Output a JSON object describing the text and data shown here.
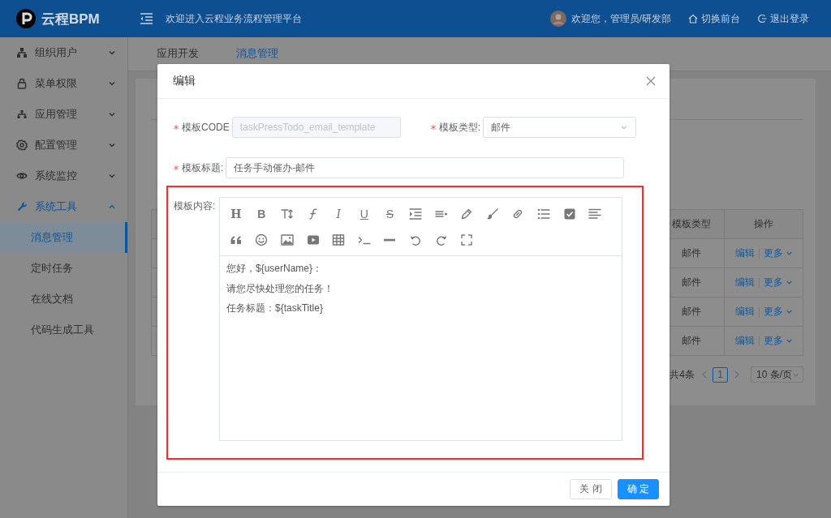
{
  "header": {
    "brand": "云程BPM",
    "welcome": "欢迎进入云程业务流程管理平台",
    "user": "欢迎您，管理员/研发部",
    "actions": [
      {
        "kind": "home",
        "label": "切换前台"
      },
      {
        "kind": "logout",
        "label": "退出登录"
      }
    ]
  },
  "sidebar": {
    "items": [
      {
        "kind": "org",
        "label": "组织用户",
        "expanded": false
      },
      {
        "kind": "lock",
        "label": "菜单权限",
        "expanded": false
      },
      {
        "kind": "apps",
        "label": "应用管理",
        "expanded": false
      },
      {
        "kind": "gear",
        "label": "配置管理",
        "expanded": false
      },
      {
        "kind": "eye",
        "label": "系统监控",
        "expanded": false
      },
      {
        "kind": "wrench",
        "label": "系统工具",
        "expanded": true,
        "children": [
          {
            "label": "消息管理",
            "selected": true
          },
          {
            "label": "定时任务",
            "selected": false
          },
          {
            "label": "在线文档",
            "selected": false
          },
          {
            "label": "代码生成工具",
            "selected": false
          }
        ]
      }
    ]
  },
  "tabs": [
    {
      "label": "应用开发",
      "selected": false
    },
    {
      "label": "消息管理",
      "selected": true
    }
  ],
  "table": {
    "columns": [
      "模板类型",
      "操作"
    ],
    "rows": [
      {
        "type": "邮件",
        "actions": [
          "编辑",
          "更多"
        ]
      },
      {
        "type": "邮件",
        "actions": [
          "编辑",
          "更多"
        ]
      },
      {
        "type": "邮件",
        "actions": [
          "编辑",
          "更多"
        ]
      },
      {
        "type": "邮件",
        "actions": [
          "编辑",
          "更多"
        ]
      }
    ]
  },
  "pagination": {
    "total": "共4条",
    "pages": [
      {
        "label": "1",
        "selected": true
      }
    ],
    "page_size": "10 条/页"
  },
  "dialog": {
    "title": "编辑",
    "form_rows": [
      [
        {
          "label": "模板CODE",
          "required": true,
          "kind": "input",
          "value": "taskPressTodo_email_template",
          "disabled": true
        },
        {
          "label": "模板类型:",
          "required": true,
          "kind": "select",
          "value": "邮件",
          "disabled": false
        }
      ],
      [
        {
          "label": "模板标题:",
          "required": true,
          "kind": "input",
          "value": "任务手动催办-邮件",
          "disabled": false
        }
      ]
    ],
    "editor": {
      "label": "模板内容:",
      "highlighted": true,
      "toolbar": [
        [
          {
            "kind": "heading",
            "glyph": "H"
          },
          {
            "kind": "bold",
            "glyph": "B"
          },
          {
            "kind": "size"
          },
          {
            "kind": "font"
          },
          {
            "kind": "italic",
            "glyph": "I"
          },
          {
            "kind": "underline",
            "glyph": "U"
          },
          {
            "kind": "strike",
            "glyph": "S"
          },
          {
            "kind": "indent"
          },
          {
            "kind": "lines"
          },
          {
            "kind": "pencil"
          },
          {
            "kind": "brush"
          },
          {
            "kind": "link"
          },
          {
            "kind": "list"
          },
          {
            "kind": "checkbox"
          },
          {
            "kind": "align"
          }
        ],
        [
          {
            "kind": "quote"
          },
          {
            "kind": "emoji"
          },
          {
            "kind": "image"
          },
          {
            "kind": "video"
          },
          {
            "kind": "table"
          },
          {
            "kind": "code"
          },
          {
            "kind": "rule"
          },
          {
            "kind": "undo"
          },
          {
            "kind": "redo"
          },
          {
            "kind": "fullscreen"
          }
        ]
      ],
      "paragraphs": [
        "您好，${userName}：",
        "请您尽快处理您的任务！",
        "任务标题：${taskTitle}"
      ]
    },
    "buttons": [
      {
        "kind": "default",
        "label": "关 闭"
      },
      {
        "kind": "primary",
        "label": "确 定"
      }
    ]
  }
}
